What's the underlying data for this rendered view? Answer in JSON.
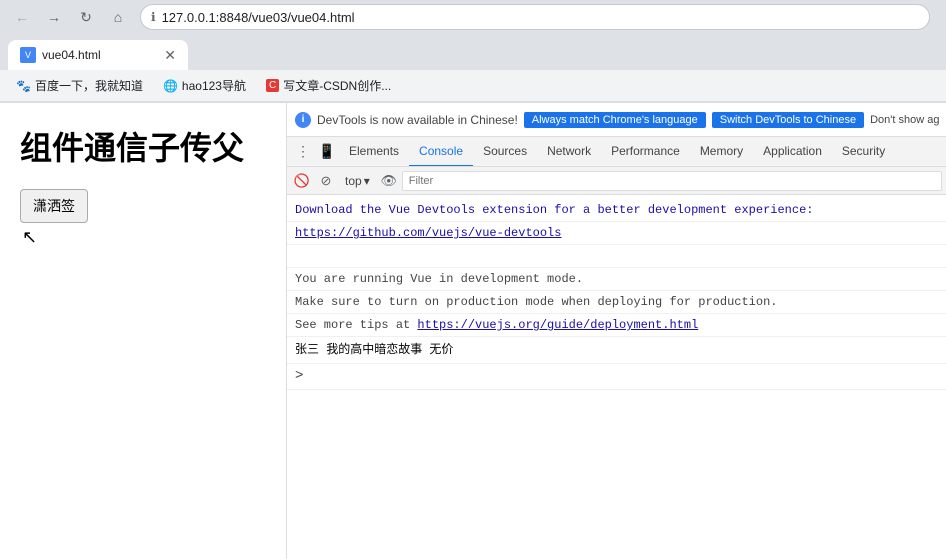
{
  "browser": {
    "url": "127.0.0.1:8848/vue03/vue04.html",
    "tab_title": "vue04.html",
    "back_btn": "←",
    "forward_btn": "→",
    "refresh_btn": "↻",
    "home_btn": "⌂"
  },
  "bookmarks": [
    {
      "label": "百度一下，我就知道",
      "icon": "🐾"
    },
    {
      "label": "hao123导航",
      "icon": "🌐"
    },
    {
      "label": "写文章-CSDN创作...",
      "icon": "C"
    }
  ],
  "webpage": {
    "title": "组件通信子传父",
    "button_label": "潇洒签"
  },
  "devtools": {
    "notification": {
      "text": "DevTools is now available in Chinese!",
      "btn_match": "Always match Chrome's language",
      "btn_switch": "Switch DevTools to Chinese",
      "btn_dont_show": "Don't show ag"
    },
    "tabs": [
      {
        "label": "Elements",
        "id": "elements"
      },
      {
        "label": "Console",
        "id": "console",
        "active": true
      },
      {
        "label": "Sources",
        "id": "sources"
      },
      {
        "label": "Network",
        "id": "network"
      },
      {
        "label": "Performance",
        "id": "performance"
      },
      {
        "label": "Memory",
        "id": "memory"
      },
      {
        "label": "Application",
        "id": "application"
      },
      {
        "label": "Security",
        "id": "security"
      }
    ],
    "console_toolbar": {
      "level_select": "top",
      "filter_placeholder": "Filter"
    },
    "console_lines": [
      {
        "type": "info",
        "text": "Download the Vue Devtools extension for a better development experience:"
      },
      {
        "type": "link",
        "text": "https://github.com/vuejs/vue-devtools"
      },
      {
        "type": "info",
        "text": ""
      },
      {
        "type": "info",
        "text": "You are running Vue in development mode."
      },
      {
        "type": "info",
        "text": "Make sure to turn on production mode when deploying for production."
      },
      {
        "type": "info_with_link",
        "before": "See more tips at ",
        "link": "https://vuejs.org/guide/deployment.html"
      },
      {
        "type": "output",
        "text": "张三 我的高中暗恋故事 无价"
      },
      {
        "type": "prompt",
        "text": ">"
      }
    ]
  }
}
